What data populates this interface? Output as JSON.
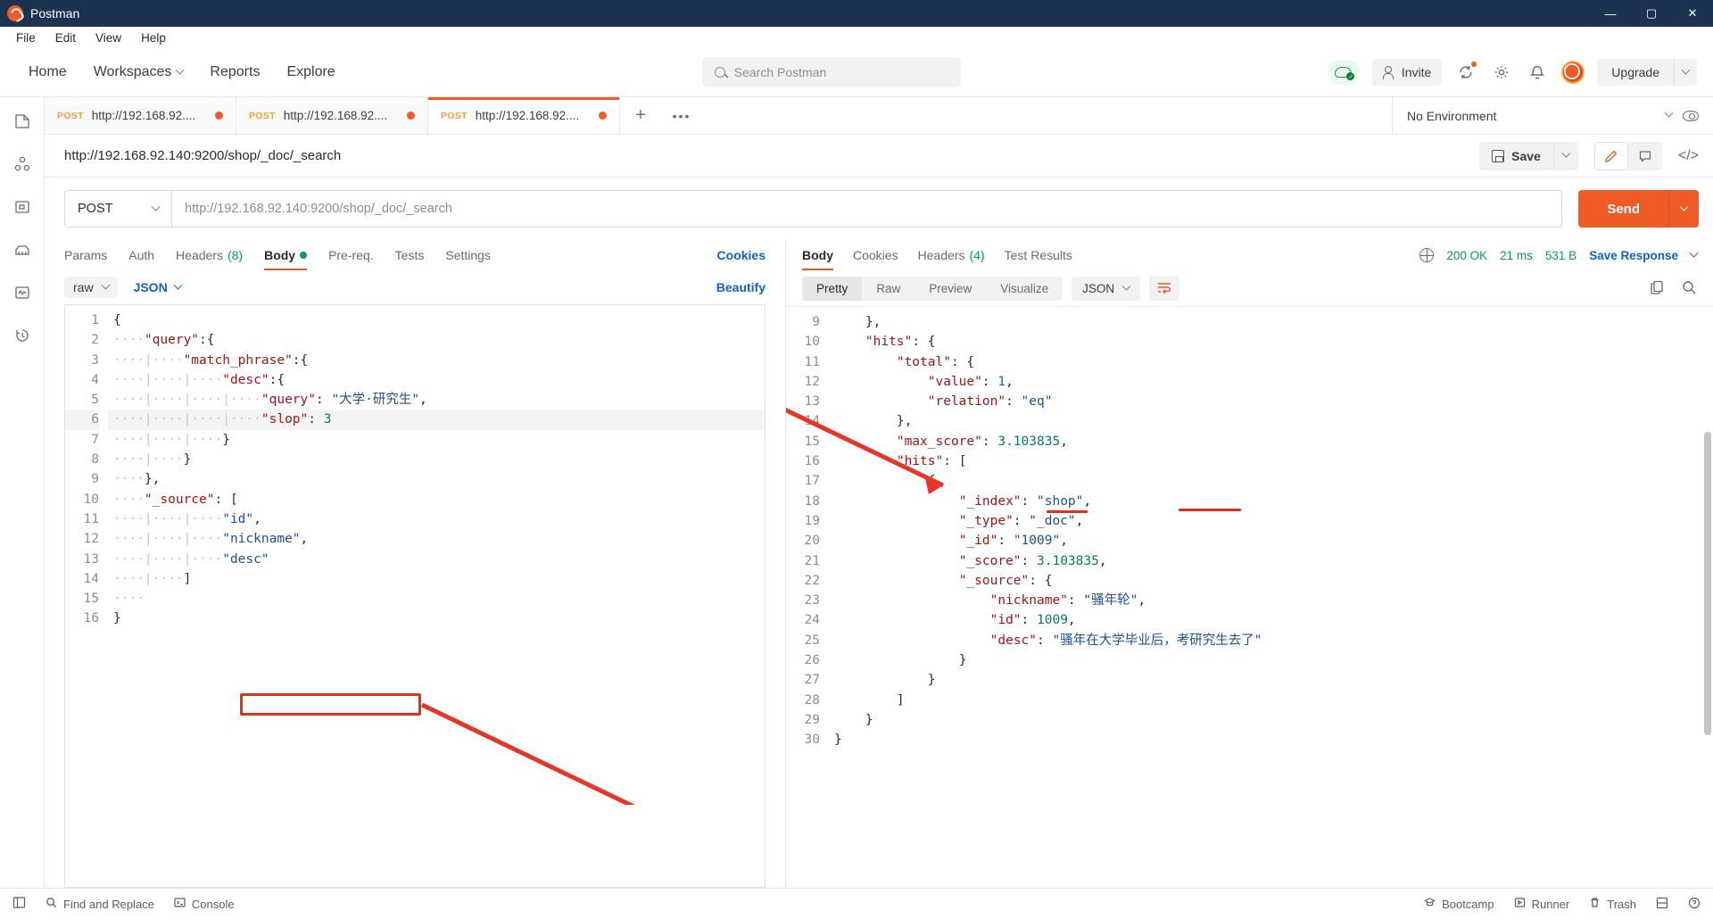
{
  "window": {
    "title": "Postman",
    "minimize": "—",
    "maximize": "▢",
    "close": "✕"
  },
  "menubar": [
    "File",
    "Edit",
    "View",
    "Help"
  ],
  "header": {
    "nav": [
      "Home",
      "Workspaces",
      "Reports",
      "Explore"
    ],
    "search_placeholder": "Search Postman",
    "invite_label": "Invite",
    "upgrade_label": "Upgrade"
  },
  "leftrail": {
    "icons": [
      "collections-icon",
      "apis-icon",
      "environments-icon",
      "mock-servers-icon",
      "monitors-icon",
      "history-icon"
    ]
  },
  "tabs": [
    {
      "method": "POST",
      "url": "http://192.168.92....",
      "active": false
    },
    {
      "method": "POST",
      "url": "http://192.168.92....",
      "active": false
    },
    {
      "method": "POST",
      "url": "http://192.168.92....",
      "active": true
    }
  ],
  "tab_actions": {
    "plus": "+",
    "more": "•••"
  },
  "environment": {
    "selected": "No Environment"
  },
  "request": {
    "title": "http://192.168.92.140:9200/shop/_doc/_search",
    "save_label": "Save",
    "method": "POST",
    "url": "http://192.168.92.140:9200/shop/_doc/_search",
    "send_label": "Send",
    "tabs": [
      {
        "label": "Params",
        "active": false
      },
      {
        "label": "Auth",
        "active": false
      },
      {
        "label": "Headers",
        "count": "(8)",
        "active": false
      },
      {
        "label": "Body",
        "active": true,
        "dot": true
      },
      {
        "label": "Pre-req.",
        "active": false
      },
      {
        "label": "Tests",
        "active": false
      },
      {
        "label": "Settings",
        "active": false
      }
    ],
    "cookies_link": "Cookies",
    "body_mode": "raw",
    "body_format": "JSON",
    "beautify_label": "Beautify",
    "code_lines": [
      {
        "no": "1",
        "segs": [
          {
            "t": "{",
            "c": "brkt"
          }
        ]
      },
      {
        "no": "2",
        "segs": [
          {
            "t": "····",
            "c": "ws"
          },
          {
            "t": "\"query\"",
            "c": "k"
          },
          {
            "t": ":{",
            "c": "brkt"
          }
        ]
      },
      {
        "no": "3",
        "segs": [
          {
            "t": "····|····",
            "c": "ws"
          },
          {
            "t": "\"match_phrase\"",
            "c": "k"
          },
          {
            "t": ":{",
            "c": "brkt"
          }
        ]
      },
      {
        "no": "4",
        "segs": [
          {
            "t": "····|····|····",
            "c": "ws"
          },
          {
            "t": "\"desc\"",
            "c": "k"
          },
          {
            "t": ":{",
            "c": "brkt"
          }
        ]
      },
      {
        "no": "5",
        "segs": [
          {
            "t": "····|····|····|····",
            "c": "ws"
          },
          {
            "t": "\"query\"",
            "c": "k"
          },
          {
            "t": ": ",
            "c": "brkt"
          },
          {
            "t": "\"大学·研究生\"",
            "c": "s"
          },
          {
            "t": ",",
            "c": "brkt"
          }
        ]
      },
      {
        "no": "6",
        "hl": true,
        "segs": [
          {
            "t": "····|····|····|····",
            "c": "ws"
          },
          {
            "t": "\"slop\"",
            "c": "k"
          },
          {
            "t": ": ",
            "c": "brkt"
          },
          {
            "t": "3",
            "c": "n"
          }
        ]
      },
      {
        "no": "7",
        "segs": [
          {
            "t": "····|····|····",
            "c": "ws"
          },
          {
            "t": "}",
            "c": "brkt"
          }
        ]
      },
      {
        "no": "8",
        "segs": [
          {
            "t": "····|····",
            "c": "ws"
          },
          {
            "t": "}",
            "c": "brkt"
          }
        ]
      },
      {
        "no": "9",
        "segs": [
          {
            "t": "····",
            "c": "ws"
          },
          {
            "t": "},",
            "c": "brkt"
          }
        ]
      },
      {
        "no": "10",
        "segs": [
          {
            "t": "····",
            "c": "ws"
          },
          {
            "t": "\"_source\"",
            "c": "k"
          },
          {
            "t": ": [",
            "c": "brkt"
          }
        ]
      },
      {
        "no": "11",
        "segs": [
          {
            "t": "····|····|····",
            "c": "ws"
          },
          {
            "t": "\"id\"",
            "c": "s"
          },
          {
            "t": ",",
            "c": "brkt"
          }
        ]
      },
      {
        "no": "12",
        "segs": [
          {
            "t": "····|····|····",
            "c": "ws"
          },
          {
            "t": "\"nickname\"",
            "c": "s"
          },
          {
            "t": ",",
            "c": "brkt"
          }
        ]
      },
      {
        "no": "13",
        "segs": [
          {
            "t": "····|····|····",
            "c": "ws"
          },
          {
            "t": "\"desc\"",
            "c": "s"
          }
        ]
      },
      {
        "no": "14",
        "segs": [
          {
            "t": "····|····",
            "c": "ws"
          },
          {
            "t": "]",
            "c": "brkt"
          }
        ]
      },
      {
        "no": "15",
        "segs": [
          {
            "t": "····",
            "c": "ws"
          }
        ]
      },
      {
        "no": "16",
        "segs": [
          {
            "t": "}",
            "c": "brkt"
          }
        ]
      }
    ]
  },
  "response": {
    "tabs": [
      {
        "label": "Body",
        "active": true
      },
      {
        "label": "Cookies",
        "active": false
      },
      {
        "label": "Headers",
        "count": "(4)",
        "active": false
      },
      {
        "label": "Test Results",
        "active": false
      }
    ],
    "status": "200 OK",
    "time": "21 ms",
    "size": "531 B",
    "save_response_label": "Save Response",
    "formats": [
      {
        "label": "Pretty",
        "sel": true
      },
      {
        "label": "Raw",
        "sel": false
      },
      {
        "label": "Preview",
        "sel": false
      },
      {
        "label": "Visualize",
        "sel": false
      }
    ],
    "format_type": "JSON",
    "code_lines": [
      {
        "no": "9",
        "segs": [
          {
            "t": "    ",
            "c": "ws"
          },
          {
            "t": "},",
            "c": "brkt"
          }
        ]
      },
      {
        "no": "10",
        "segs": [
          {
            "t": "    ",
            "c": "ws"
          },
          {
            "t": "\"hits\"",
            "c": "k"
          },
          {
            "t": ": {",
            "c": "brkt"
          }
        ]
      },
      {
        "no": "11",
        "segs": [
          {
            "t": "        ",
            "c": "ws"
          },
          {
            "t": "\"total\"",
            "c": "k"
          },
          {
            "t": ": {",
            "c": "brkt"
          }
        ]
      },
      {
        "no": "12",
        "segs": [
          {
            "t": "            ",
            "c": "ws"
          },
          {
            "t": "\"value\"",
            "c": "k"
          },
          {
            "t": ": ",
            "c": "brkt"
          },
          {
            "t": "1",
            "c": "n"
          },
          {
            "t": ",",
            "c": "brkt"
          }
        ]
      },
      {
        "no": "13",
        "segs": [
          {
            "t": "            ",
            "c": "ws"
          },
          {
            "t": "\"relation\"",
            "c": "k"
          },
          {
            "t": ": ",
            "c": "brkt"
          },
          {
            "t": "\"eq\"",
            "c": "s"
          }
        ]
      },
      {
        "no": "14",
        "segs": [
          {
            "t": "        ",
            "c": "ws"
          },
          {
            "t": "},",
            "c": "brkt"
          }
        ]
      },
      {
        "no": "15",
        "segs": [
          {
            "t": "        ",
            "c": "ws"
          },
          {
            "t": "\"max_score\"",
            "c": "k"
          },
          {
            "t": ": ",
            "c": "brkt"
          },
          {
            "t": "3.103835",
            "c": "n"
          },
          {
            "t": ",",
            "c": "brkt"
          }
        ]
      },
      {
        "no": "16",
        "segs": [
          {
            "t": "        ",
            "c": "ws"
          },
          {
            "t": "\"hits\"",
            "c": "k"
          },
          {
            "t": ": [",
            "c": "brkt"
          }
        ]
      },
      {
        "no": "17",
        "segs": [
          {
            "t": "            ",
            "c": "ws"
          },
          {
            "t": "{",
            "c": "brkt"
          }
        ]
      },
      {
        "no": "18",
        "segs": [
          {
            "t": "                ",
            "c": "ws"
          },
          {
            "t": "\"_index\"",
            "c": "k"
          },
          {
            "t": ": ",
            "c": "brkt"
          },
          {
            "t": "\"shop\"",
            "c": "s"
          },
          {
            "t": ",",
            "c": "brkt"
          }
        ]
      },
      {
        "no": "19",
        "segs": [
          {
            "t": "                ",
            "c": "ws"
          },
          {
            "t": "\"_type\"",
            "c": "k"
          },
          {
            "t": ": ",
            "c": "brkt"
          },
          {
            "t": "\"_doc\"",
            "c": "s"
          },
          {
            "t": ",",
            "c": "brkt"
          }
        ]
      },
      {
        "no": "20",
        "segs": [
          {
            "t": "                ",
            "c": "ws"
          },
          {
            "t": "\"_id\"",
            "c": "k"
          },
          {
            "t": ": ",
            "c": "brkt"
          },
          {
            "t": "\"1009\"",
            "c": "s"
          },
          {
            "t": ",",
            "c": "brkt"
          }
        ]
      },
      {
        "no": "21",
        "segs": [
          {
            "t": "                ",
            "c": "ws"
          },
          {
            "t": "\"_score\"",
            "c": "k"
          },
          {
            "t": ": ",
            "c": "brkt"
          },
          {
            "t": "3.103835",
            "c": "n"
          },
          {
            "t": ",",
            "c": "brkt"
          }
        ]
      },
      {
        "no": "22",
        "segs": [
          {
            "t": "                ",
            "c": "ws"
          },
          {
            "t": "\"_source\"",
            "c": "k"
          },
          {
            "t": ": {",
            "c": "brkt"
          }
        ]
      },
      {
        "no": "23",
        "segs": [
          {
            "t": "                    ",
            "c": "ws"
          },
          {
            "t": "\"nickname\"",
            "c": "k"
          },
          {
            "t": ": ",
            "c": "brkt"
          },
          {
            "t": "\"骚年轮\"",
            "c": "s"
          },
          {
            "t": ",",
            "c": "brkt"
          }
        ]
      },
      {
        "no": "24",
        "segs": [
          {
            "t": "                    ",
            "c": "ws"
          },
          {
            "t": "\"id\"",
            "c": "k"
          },
          {
            "t": ": ",
            "c": "brkt"
          },
          {
            "t": "1009",
            "c": "n"
          },
          {
            "t": ",",
            "c": "brkt"
          }
        ]
      },
      {
        "no": "25",
        "segs": [
          {
            "t": "                    ",
            "c": "ws"
          },
          {
            "t": "\"desc\"",
            "c": "k"
          },
          {
            "t": ": ",
            "c": "brkt"
          },
          {
            "t": "\"骚年在大学毕业后，考研究生去了\"",
            "c": "s"
          }
        ]
      },
      {
        "no": "26",
        "segs": [
          {
            "t": "                ",
            "c": "ws"
          },
          {
            "t": "}",
            "c": "brkt"
          }
        ]
      },
      {
        "no": "27",
        "segs": [
          {
            "t": "            ",
            "c": "ws"
          },
          {
            "t": "}",
            "c": "brkt"
          }
        ]
      },
      {
        "no": "28",
        "segs": [
          {
            "t": "        ",
            "c": "ws"
          },
          {
            "t": "]",
            "c": "brkt"
          }
        ]
      },
      {
        "no": "29",
        "segs": [
          {
            "t": "    ",
            "c": "ws"
          },
          {
            "t": "}",
            "c": "brkt"
          }
        ]
      },
      {
        "no": "30",
        "segs": [
          {
            "t": "}",
            "c": "brkt"
          }
        ]
      }
    ]
  },
  "statusbar": {
    "find_replace": "Find and Replace",
    "console": "Console",
    "bootcamp": "Bootcamp",
    "runner": "Runner",
    "trash": "Trash"
  },
  "annotations": {
    "highlight_color": "#e03020",
    "boxed_text": "\"slop\": 3",
    "underlined_terms": [
      "大学",
      "研究生"
    ]
  }
}
